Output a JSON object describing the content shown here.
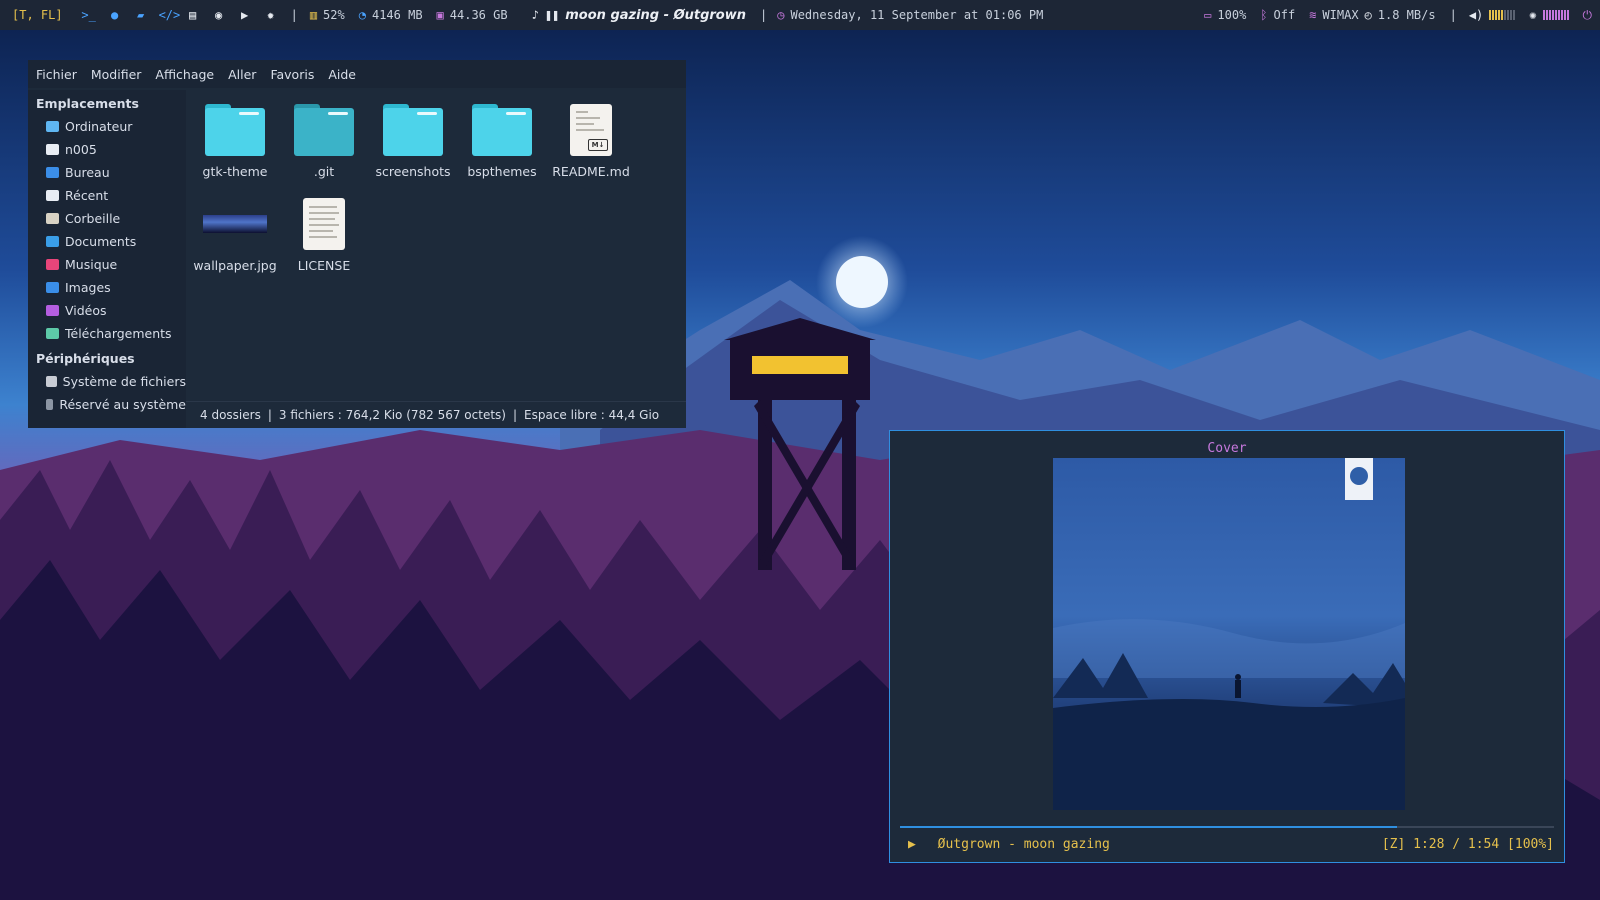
{
  "topbar": {
    "workspace": "[T, FL]",
    "launchers": [
      "terminal-icon",
      "firefox-icon",
      "files-icon",
      "code-icon",
      "book-icon",
      "chat-icon",
      "youtube-icon",
      "settings-icon"
    ],
    "cpu": "52%",
    "ram": "4146 MB",
    "disk": "44.36 GB",
    "now_playing": "moon gazing - Øutgrown",
    "datetime": "Wednesday, 11 September at 01:06 PM",
    "battery": "100%",
    "bluetooth": "Off",
    "network": "WIMAX",
    "net_speed": "1.8 MB/s",
    "colors": {
      "accent_yellow": "#e5c04c",
      "accent_blue": "#4aa3ff",
      "accent_pink": "#c678dd"
    }
  },
  "file_manager": {
    "menu": [
      "Fichier",
      "Modifier",
      "Affichage",
      "Aller",
      "Favoris",
      "Aide"
    ],
    "sidebar_sections": [
      {
        "title": "Emplacements",
        "items": [
          {
            "label": "Ordinateur",
            "color": "#5fb6f2"
          },
          {
            "label": "n005",
            "color": "#e8edf4"
          },
          {
            "label": "Bureau",
            "color": "#3b8ee8"
          },
          {
            "label": "Récent",
            "color": "#e8edf4"
          },
          {
            "label": "Corbeille",
            "color": "#d8d2c4"
          },
          {
            "label": "Documents",
            "color": "#3a9ee8"
          },
          {
            "label": "Musique",
            "color": "#e8457a"
          },
          {
            "label": "Images",
            "color": "#3a8ee8"
          },
          {
            "label": "Vidéos",
            "color": "#b45ee0"
          },
          {
            "label": "Téléchargements",
            "color": "#5dc9a8"
          }
        ]
      },
      {
        "title": "Périphériques",
        "items": [
          {
            "label": "Système de fichiers",
            "color": "#c8ccd4"
          },
          {
            "label": "Réservé au système",
            "color": "#8c96a4"
          }
        ]
      }
    ],
    "files": [
      {
        "name": "gtk-theme",
        "kind": "folder"
      },
      {
        "name": ".git",
        "kind": "folder-dim"
      },
      {
        "name": "screenshots",
        "kind": "folder"
      },
      {
        "name": "bspthemes",
        "kind": "folder"
      },
      {
        "name": "README.md",
        "kind": "markdown"
      },
      {
        "name": "wallpaper.jpg",
        "kind": "image"
      },
      {
        "name": "LICENSE",
        "kind": "text"
      }
    ],
    "status": {
      "folders": "4 dossiers",
      "files": "3 fichiers : 764,2 Kio (782 567 octets)",
      "free": "Espace libre : 44,4 Gio"
    }
  },
  "player": {
    "panel_title": "Cover",
    "track": "Øutgrown - moon gazing",
    "position": "[Z] 1:28 / 1:54 [100%]",
    "progress": 0.76
  }
}
